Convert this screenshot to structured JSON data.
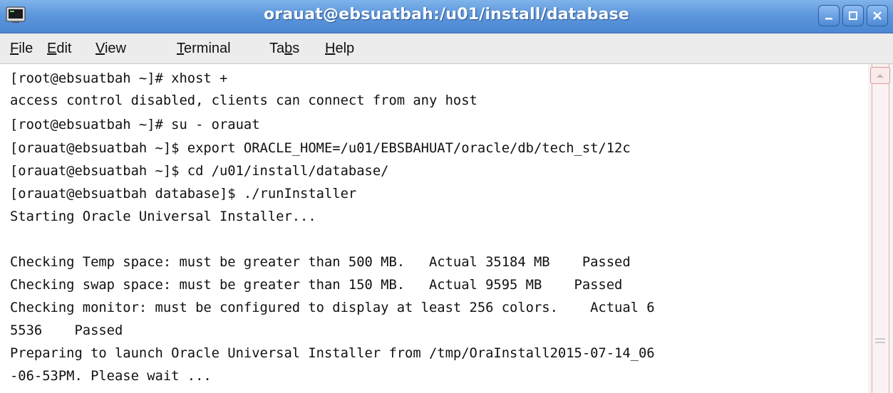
{
  "window": {
    "title": "orauat@ebsuatbah:/u01/install/database"
  },
  "menu": {
    "items": [
      {
        "mnemonic": "F",
        "rest": "ile"
      },
      {
        "mnemonic": "E",
        "rest": "dit"
      },
      {
        "mnemonic": "V",
        "rest": "iew"
      },
      {
        "mnemonic": "T",
        "rest": "erminal"
      },
      {
        "pre": "Ta",
        "mnemonic": "b",
        "rest": "s"
      },
      {
        "mnemonic": "H",
        "rest": "elp"
      }
    ]
  },
  "terminal": {
    "lines": [
      "[root@ebsuatbah ~]# xhost +",
      "access control disabled, clients can connect from any host",
      "[root@ebsuatbah ~]# su - orauat",
      "[orauat@ebsuatbah ~]$ export ORACLE_HOME=/u01/EBSBAHUAT/oracle/db/tech_st/12c",
      "[orauat@ebsuatbah ~]$ cd /u01/install/database/",
      "[orauat@ebsuatbah database]$ ./runInstaller",
      "Starting Oracle Universal Installer...",
      "",
      "Checking Temp space: must be greater than 500 MB.   Actual 35184 MB    Passed",
      "Checking swap space: must be greater than 150 MB.   Actual 9595 MB    Passed",
      "Checking monitor: must be configured to display at least 256 colors.    Actual 6",
      "5536    Passed",
      "Preparing to launch Oracle Universal Installer from /tmp/OraInstall2015-07-14_06",
      "-06-53PM. Please wait ..."
    ]
  },
  "colors": {
    "titlebar": "#5d97dc",
    "menubar": "#ececec",
    "terminal_bg": "#ffffff",
    "terminal_fg": "#111111"
  }
}
